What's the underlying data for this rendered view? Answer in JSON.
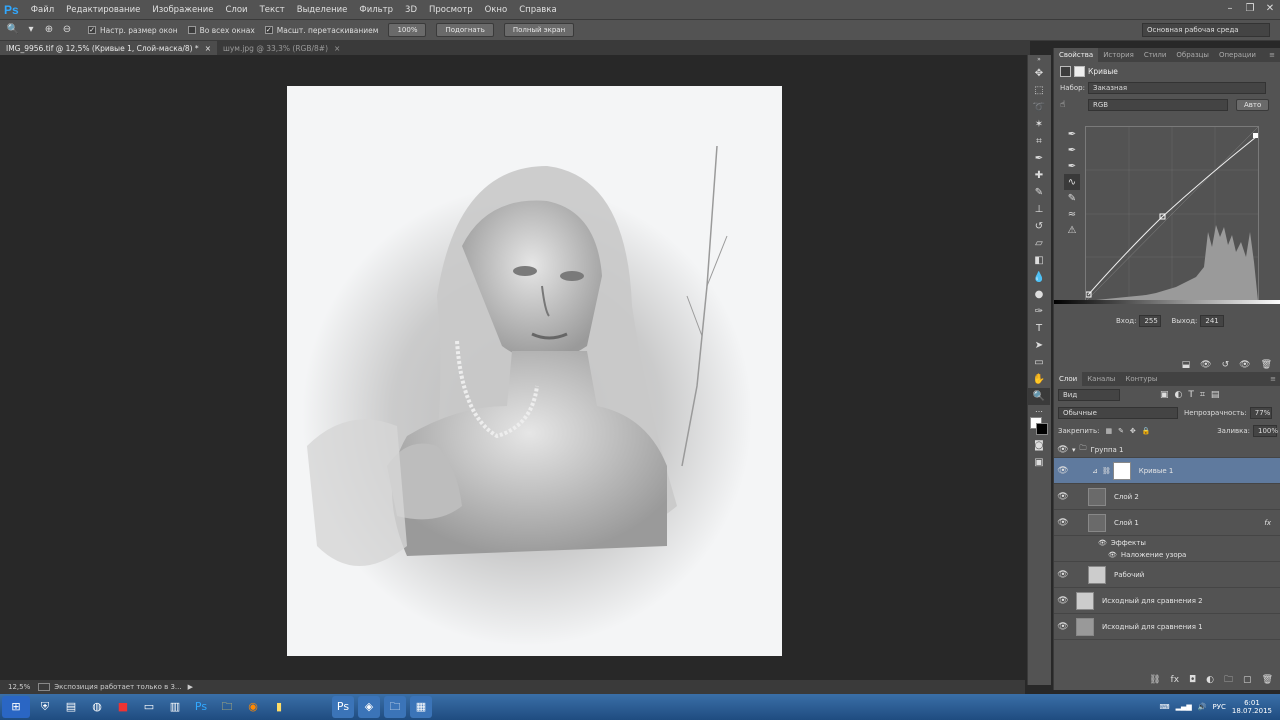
{
  "app": {
    "logo": "Ps"
  },
  "menu": [
    "Файл",
    "Редактирование",
    "Изображение",
    "Слои",
    "Текст",
    "Выделение",
    "Фильтр",
    "3D",
    "Просмотр",
    "Окно",
    "Справка"
  ],
  "options": {
    "chk1": "Настр. размер окон",
    "chk2": "Во всех окнах",
    "chk3": "Масшт. перетаскиванием",
    "btn1": "100%",
    "btn2": "Подогнать",
    "btn3": "Полный экран",
    "workspace": "Основная рабочая среда"
  },
  "tabs": {
    "tab1": "IMG_9956.tif @ 12,5% (Кривые 1, Слой-маска/8) *",
    "tab2": "шум.jpg @ 33,3% (RGB/8#)"
  },
  "status": {
    "zoom": "12,5%",
    "text": "Экспозиция работает только в 3..."
  },
  "properties": {
    "tabs": [
      "Свойства",
      "История",
      "Стили",
      "Образцы",
      "Операции"
    ],
    "title": "Кривые",
    "preset_label": "Набор:",
    "preset_value": "Заказная",
    "channel": "RGB",
    "auto": "Авто",
    "input_label": "Вход:",
    "input_value": "255",
    "output_label": "Выход:",
    "output_value": "241"
  },
  "layers_panel": {
    "tabs": [
      "Слои",
      "Каналы",
      "Контуры"
    ],
    "filter": "Вид",
    "blend": "Обычные",
    "opacity_label": "Непрозрачность:",
    "opacity": "77%",
    "lock_label": "Закрепить:",
    "fill_label": "Заливка:",
    "fill": "100%",
    "group": "Группа 1",
    "layers": [
      "Кривые 1",
      "Слой 2",
      "Слой 1",
      "Рабочий",
      "Исходный для сравнения 2",
      "Исходный для сравнения 1"
    ],
    "effects": "Эффекты",
    "pattern_overlay": "Наложение узора"
  },
  "tray": {
    "lang": "РУС",
    "time": "6:01",
    "date": "18.07.2015"
  }
}
